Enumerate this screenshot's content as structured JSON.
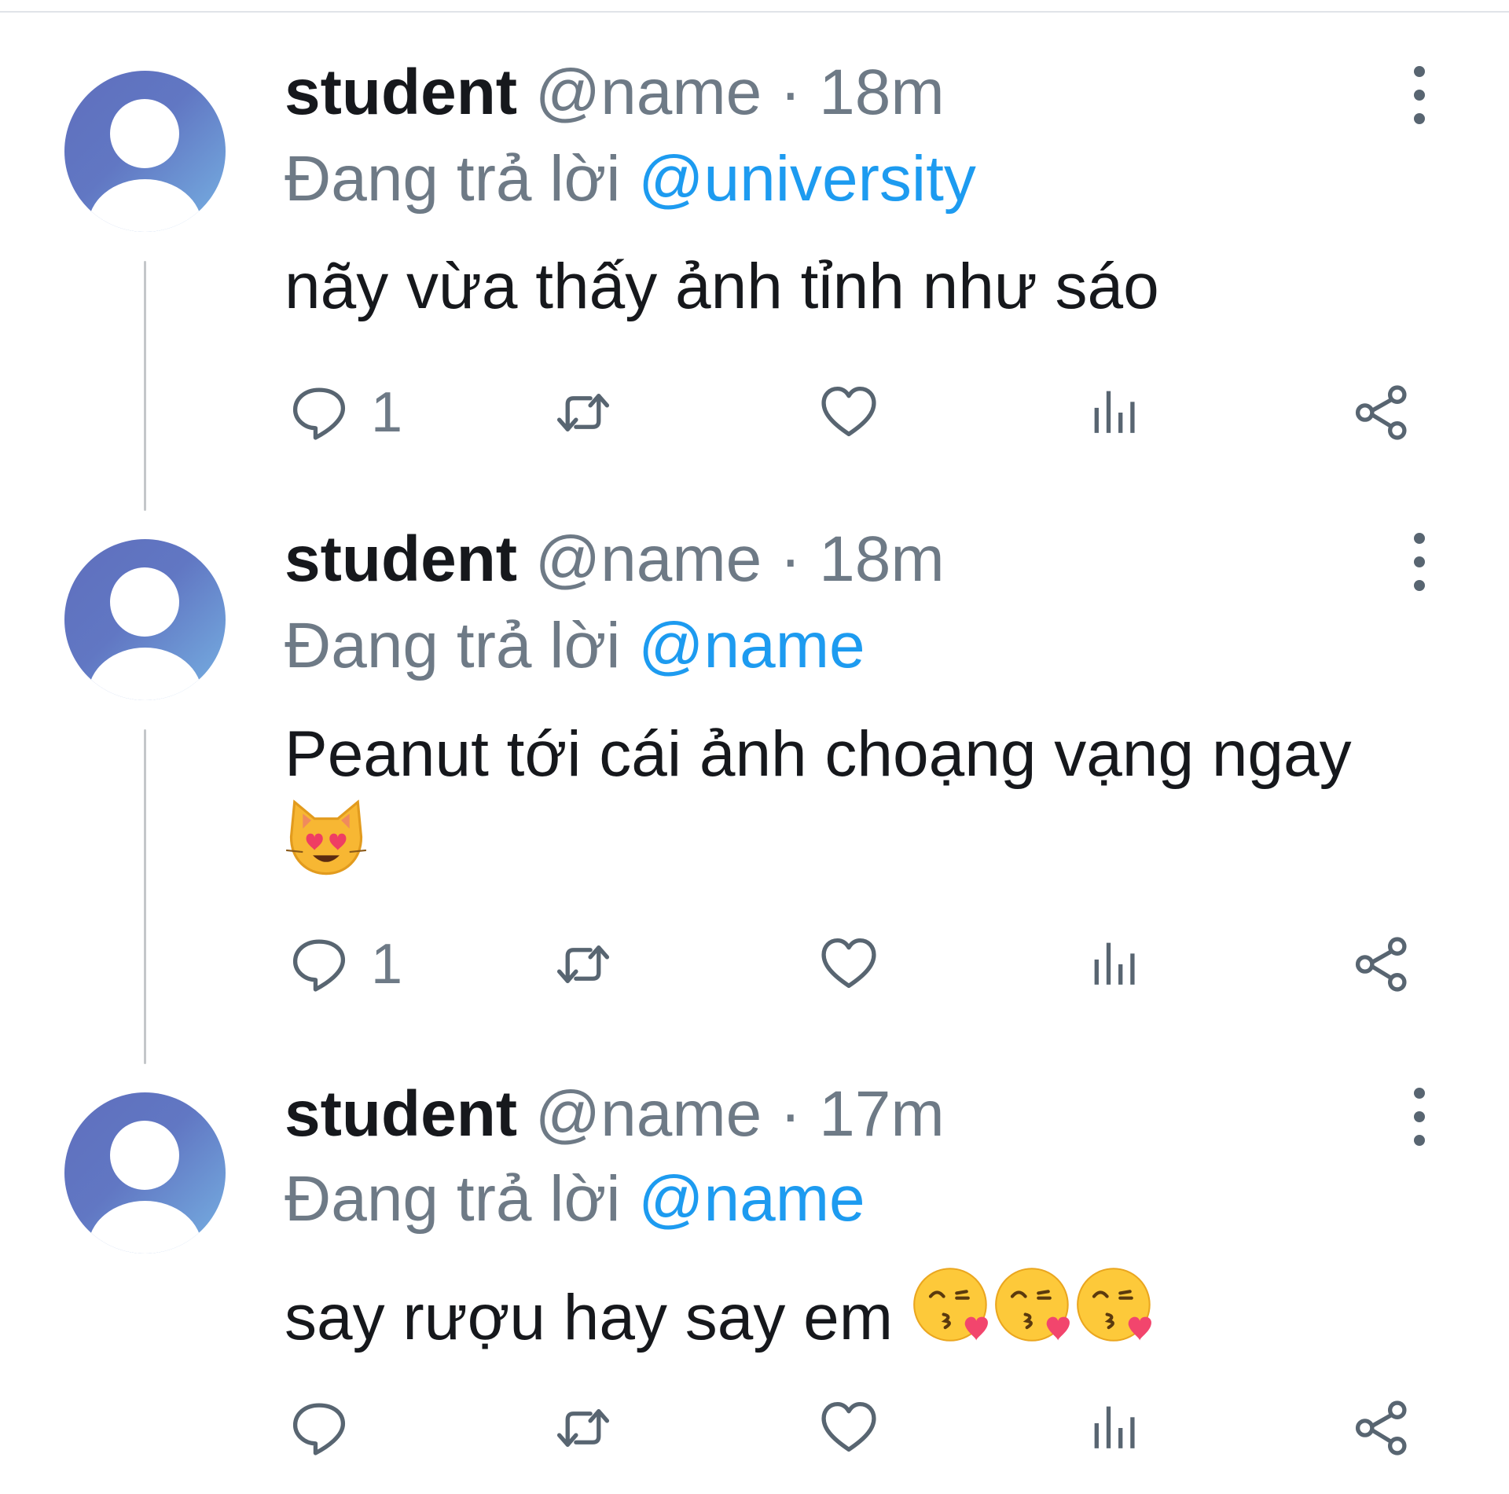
{
  "tweets": [
    {
      "display_name": "student",
      "handle": "@name",
      "separator": "·",
      "time": "18m",
      "replying_label": "Đang trả lời",
      "replying_to": "@university",
      "text": "nãy vừa thấy ảnh tỉnh như sáo",
      "emoji": [],
      "reply_count": "1"
    },
    {
      "display_name": "student",
      "handle": "@name",
      "separator": "·",
      "time": "18m",
      "replying_label": "Đang trả lời",
      "replying_to": "@name",
      "text": "Peanut tới cái ảnh choạng vạng ngay",
      "emoji": [
        "😻"
      ],
      "reply_count": "1"
    },
    {
      "display_name": "student",
      "handle": "@name",
      "separator": "·",
      "time": "17m",
      "replying_label": "Đang trả lời",
      "replying_to": "@name",
      "text": "say rượu hay say em",
      "emoji": [
        "😘",
        "😘",
        "😘"
      ],
      "reply_count": ""
    }
  ],
  "colors": {
    "text": "#16181c",
    "muted": "#6e7a86",
    "mention": "#1d9bf0",
    "icon": "#586571",
    "thread_line": "#c4c7ca",
    "avatar_gradient": [
      "#5f6fbd",
      "#77b2e3"
    ]
  },
  "icons": {
    "reply": "reply-icon",
    "retweet": "retweet-icon",
    "like": "heart-icon",
    "views": "views-icon",
    "share": "share-icon",
    "more": "more-vertical-icon",
    "avatar": "default-avatar-icon"
  }
}
